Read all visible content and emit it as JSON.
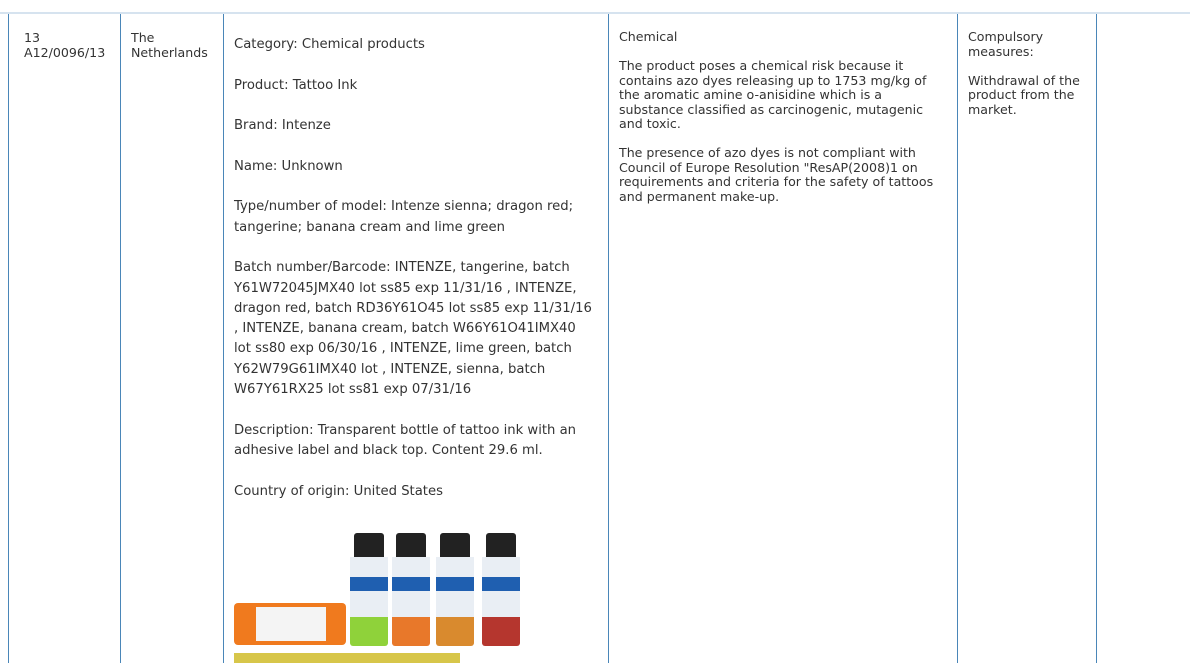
{
  "row": {
    "number_line1": "13",
    "number_line2": "A12/0096/13",
    "country_line1": "The",
    "country_line2": "Netherlands",
    "product_details": [
      "Category: Chemical products",
      "Product: Tattoo Ink",
      "Brand: Intenze",
      "Name: Unknown",
      "Type/number of model: Intenze sienna; dragon red; tangerine; banana cream and lime green",
      "Batch number/Barcode: INTENZE, tangerine, batch Y61W72045JMX40 lot ss85 exp 11/31/16 , INTENZE, dragon red, batch RD36Y61O45 lot ss85 exp 11/31/16 , INTENZE, banana cream, batch W66Y61O41IMX40 lot ss80 exp 06/30/16 , INTENZE, lime green, batch Y62W79G61IMX40 lot , INTENZE, sienna, batch W67Y61RX25 lot ss81 exp 07/31/16",
      "Description: Transparent bottle of tattoo ink with an adhesive label and black top. Content 29.6 ml.",
      "Country of origin: United States"
    ],
    "risk_type": "Chemical",
    "risk_paragraphs": [
      "The product poses a chemical risk because it contains azo dyes releasing up to 1753 mg/kg of the aromatic amine o-anisidine which is a substance classified as carcinogenic, mutagenic and toxic.",
      "The presence of azo dyes is not compliant with Council of Europe Resolution \"ResAP(2008)1 on requirements and criteria for the safety of tattoos and permanent make-up."
    ],
    "measures_type": "Compulsory measures:",
    "measures_text": "Withdrawal of the product from the market."
  },
  "photo_bottles": [
    {
      "ink_color": "#8fd23a"
    },
    {
      "ink_color": "#e8782a"
    },
    {
      "ink_color": "#d98a2e"
    },
    {
      "ink_color": "#b5362e"
    }
  ]
}
